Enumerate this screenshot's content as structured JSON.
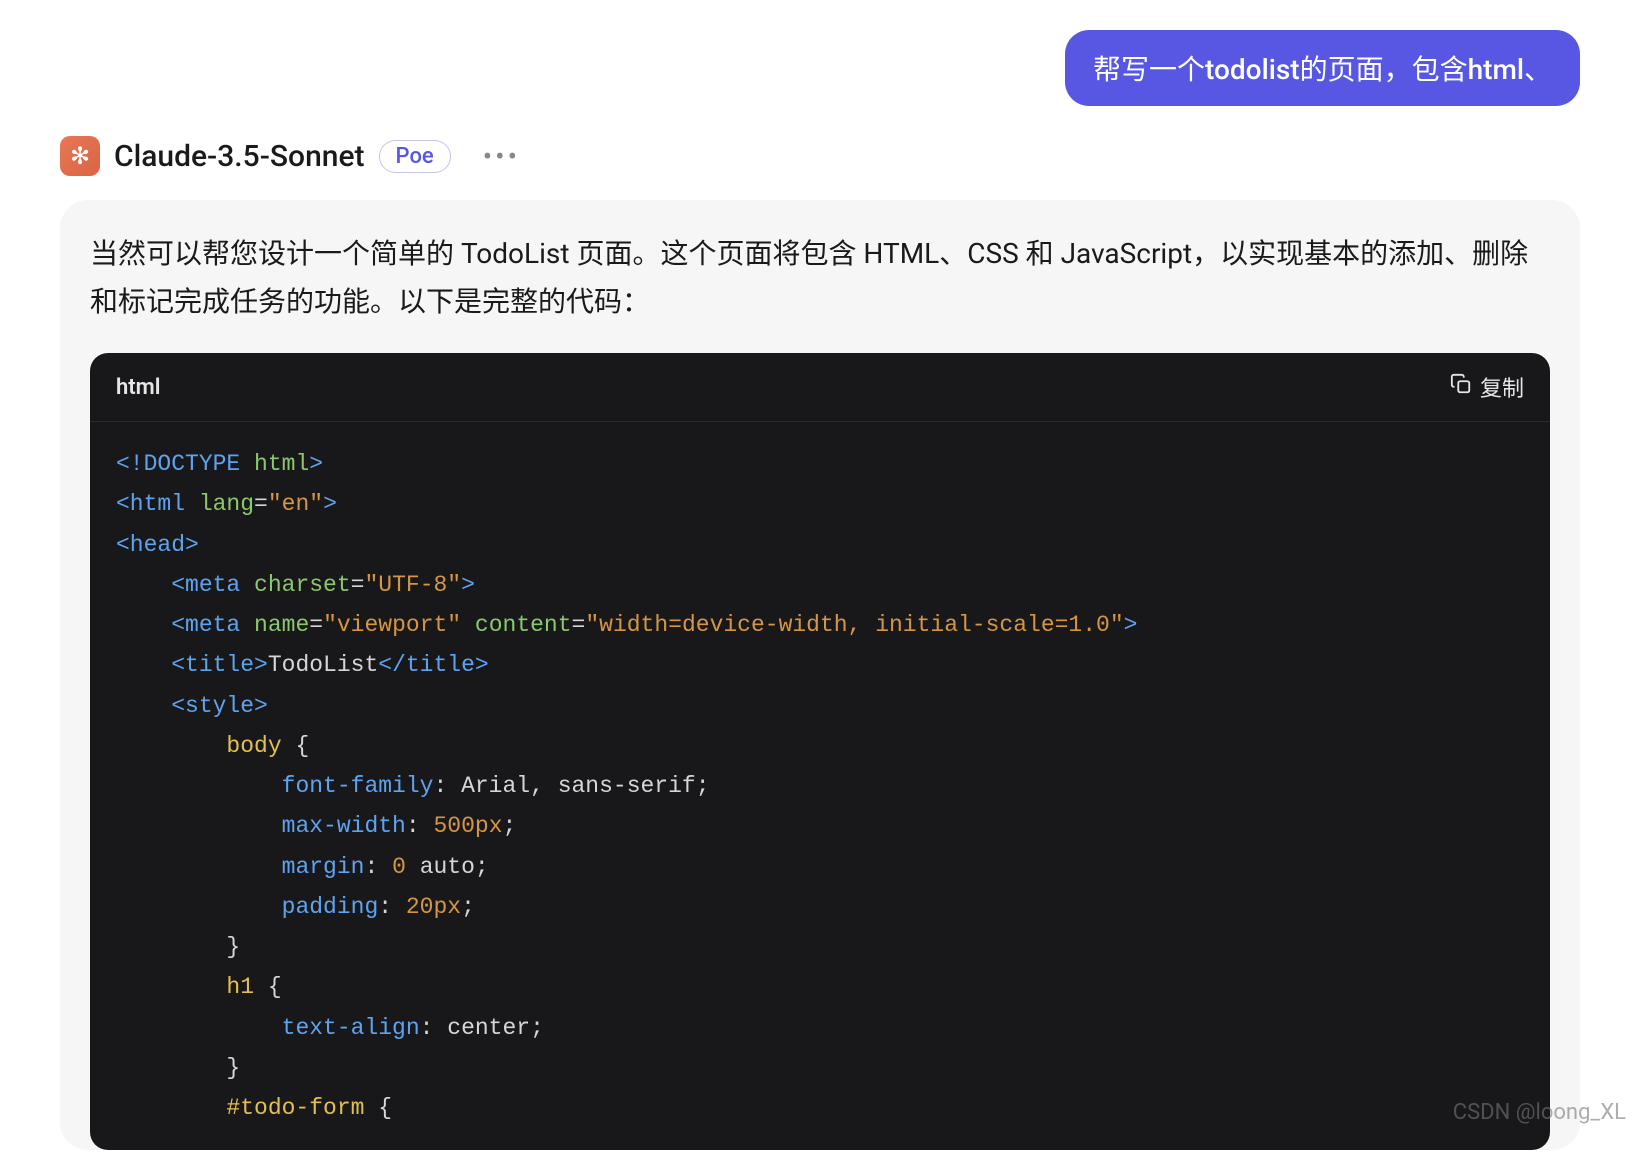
{
  "user": {
    "message": "帮写一个todolist的页面，包含html、"
  },
  "bot": {
    "name": "Claude-3.5-Sonnet",
    "badge": "Poe",
    "avatar_icon": "✻",
    "text": "当然可以帮您设计一个简单的 TodoList 页面。这个页面将包含 HTML、CSS 和 JavaScript，以实现基本的添加、删除和标记完成任务的功能。以下是完整的代码："
  },
  "code": {
    "language": "html",
    "copy_label": "复制"
  },
  "code_tokens": {
    "t_doctype_open": "<!DOCTYPE ",
    "t_doctype_name": "html",
    "t_doctype_close": ">",
    "t_html_open": "<html ",
    "t_lang_attr": "lang",
    "t_eq": "=",
    "t_lang_val": "\"en\"",
    "t_gt": ">",
    "t_head_open": "<head>",
    "t_meta_open1": "<meta ",
    "t_charset_attr": "charset",
    "t_charset_val": "\"UTF-8\"",
    "t_meta_open2": "<meta ",
    "t_name_attr": "name",
    "t_name_val": "\"viewport\"",
    "t_content_attr": " content",
    "t_content_val": "\"width=device-width, initial-scale=1.0\"",
    "t_title_open": "<title>",
    "t_title_text": "TodoList",
    "t_title_close": "</title>",
    "t_style_open": "<style>",
    "sel_body": "body",
    "brace_open": " {",
    "brace_close": "}",
    "prop_ff": "font-family",
    "val_ff": ": Arial, sans-serif;",
    "prop_mw": "max-width",
    "val_mw_colon": ": ",
    "val_mw_num": "500px",
    "val_semi": ";",
    "prop_margin": "margin",
    "val_margin_colon": ": ",
    "val_margin_num": "0",
    "val_margin_auto": " auto;",
    "prop_padding": "padding",
    "val_padding_colon": ": ",
    "val_padding_num": "20px",
    "sel_h1": "h1",
    "prop_ta": "text-align",
    "val_ta": ": center;",
    "sel_todo": "#todo-form"
  },
  "watermark": "CSDN @loong_XL"
}
